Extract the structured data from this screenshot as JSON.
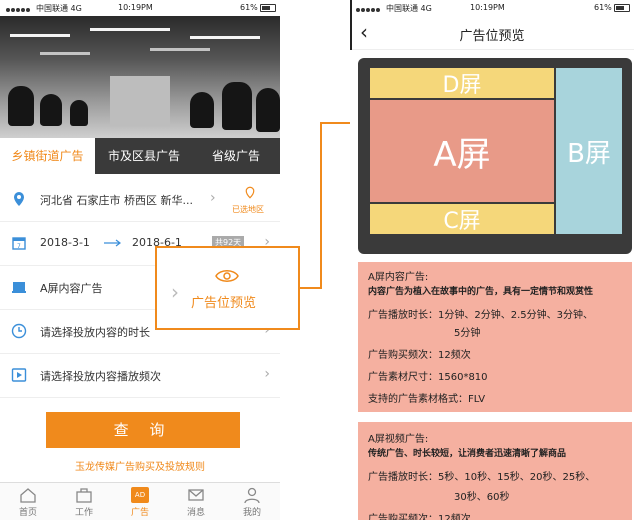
{
  "left": {
    "status": {
      "carrier": "中国联通 4G",
      "time": "10:19PM",
      "battery": "61%"
    },
    "tabs": [
      {
        "label": "乡镇街道广告",
        "active": true
      },
      {
        "label": "市及区县广告",
        "active": false
      },
      {
        "label": "省级广告",
        "active": false
      }
    ],
    "location": {
      "text": "河北省  石家庄市  桥西区  新华...",
      "badge": "已选地区"
    },
    "dates": {
      "start": "2018-3-1",
      "end": "2018-6-1",
      "tag": "共92天"
    },
    "ad_type": "A屏内容广告",
    "duration_placeholder": "请选择投放内容的时长",
    "frequency_placeholder": "请选择投放内容播放频次",
    "query_button": "查 询",
    "rules_link": "玉龙传媒广告购买及投放规则",
    "nav": [
      {
        "label": "首页",
        "icon": "home-icon"
      },
      {
        "label": "工作",
        "icon": "briefcase-icon"
      },
      {
        "label": "广告",
        "icon": "ad-icon",
        "active": true,
        "badge": "AD"
      },
      {
        "label": "消息",
        "icon": "mail-icon"
      },
      {
        "label": "我的",
        "icon": "user-icon"
      }
    ],
    "popup_label": "广告位预览"
  },
  "right": {
    "status": {
      "carrier": "中国联通 4G",
      "time": "10:19PM",
      "battery": "61%"
    },
    "title": "广告位预览",
    "screens": {
      "d": "D屏",
      "a": "A屏",
      "b": "B屏",
      "c": "C屏"
    },
    "card1": {
      "title": "A屏内容广告:",
      "subtitle": "内容广告为植入在故事中的广告，具有一定情节和观赏性",
      "duration_label": "广告播放时长：1分钟、2分钟、2.5分钟、3分钟、",
      "duration_cont": "5分钟",
      "frequency": "广告购买频次：12频次",
      "size": "广告素材尺寸：1560*810",
      "format": "支持的广告素材格式：FLV"
    },
    "card2": {
      "title": "A屏视频广告:",
      "subtitle": "传统广告、时长较短，让消费者迅速清晰了解商品",
      "duration_label": "广告播放时长：5秒、10秒、15秒、20秒、25秒、",
      "duration_cont": "30秒、60秒",
      "frequency": "广告购买频次：12频次"
    }
  },
  "colors": {
    "accent": "#f08a1c",
    "screen_a": "#e89a88",
    "screen_b": "#a8d4dc",
    "screen_dc": "#f5d77a",
    "card": "#f5b0a0"
  }
}
